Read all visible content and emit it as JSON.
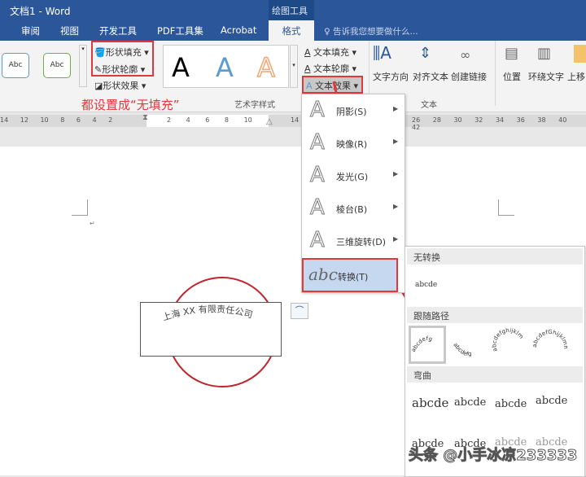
{
  "window": {
    "title": "文档1 - Word",
    "context_tab_group": "绘图工具"
  },
  "tabs": [
    "审阅",
    "视图",
    "开发工具",
    "PDF工具集",
    "Acrobat",
    "格式"
  ],
  "tell_me": "告诉我您想要做什么...",
  "ribbon": {
    "shape_styles": [
      "Abc",
      "Abc"
    ],
    "shape_fill": "形状填充",
    "shape_outline": "形状轮廓",
    "shape_effects": "形状效果",
    "wordart_letters": [
      "A",
      "A",
      "A"
    ],
    "wordart_group": "艺术字样式",
    "text_fill": "文本填充",
    "text_outline": "文本轮廓",
    "text_effects": "文本效果",
    "text_direction": "文字方向",
    "align_text": "对齐文本",
    "create_link": "创建链接",
    "text_group": "文本",
    "position": "位置",
    "wrap_text": "环绕文字",
    "bring_forward": "上移"
  },
  "annotation": "都设置成“无填充”",
  "ruler": {
    "left": [
      "14",
      "12",
      "10",
      "8",
      "6",
      "4",
      "2"
    ],
    "mid": [
      "2",
      "4",
      "6",
      "8",
      "10"
    ],
    "right_a": [
      "14"
    ],
    "right": [
      "26",
      "28",
      "30",
      "32",
      "34",
      "36",
      "38",
      "40",
      "42"
    ]
  },
  "text_effects_menu": [
    {
      "label": "阴影(S)"
    },
    {
      "label": "映像(R)"
    },
    {
      "label": "发光(G)"
    },
    {
      "label": "棱台(B)"
    },
    {
      "label": "三维旋转(D)"
    },
    {
      "label": "转换(T)",
      "selected": true
    }
  ],
  "transform_submenu": {
    "no_transform": "无转换",
    "no_transform_sample": "abcde",
    "follow_path": "跟随路径",
    "follow_samples": [
      "abcdefg",
      "abcdefg",
      "abcdefghijklm",
      "abcdefGhijklmnop"
    ],
    "warp": "弯曲",
    "warp_samples": [
      "abcde",
      "abcde",
      "abcde",
      "abcde",
      "abcde",
      "abcde",
      "abcde",
      "abcde"
    ]
  },
  "document": {
    "textbox_text": "上海 XX 有限责任公司"
  },
  "watermark": "头条 @小手冰凉233333",
  "colors": {
    "title_blue": "#2b579a",
    "highlight_red": "#e0383b",
    "circle": "#c0262d",
    "selected_item": "#c5d8f0"
  }
}
